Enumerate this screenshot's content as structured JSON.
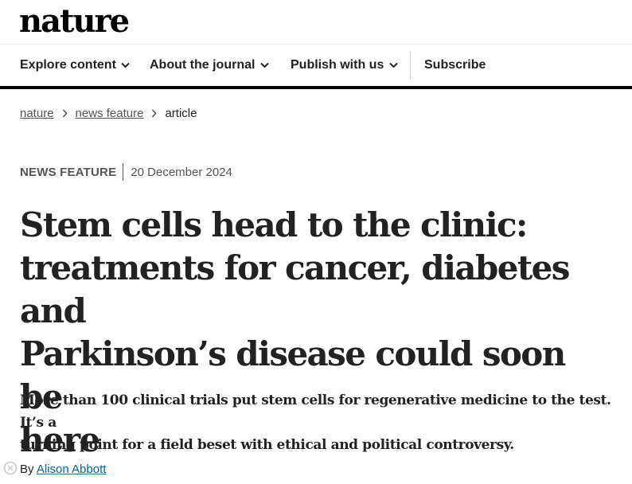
{
  "brand": {
    "logo_text": "nature"
  },
  "nav": {
    "items": [
      {
        "label": "Explore content",
        "has_dropdown": true
      },
      {
        "label": "About the journal",
        "has_dropdown": true
      },
      {
        "label": "Publish with us",
        "has_dropdown": true
      }
    ],
    "subscribe_label": "Subscribe"
  },
  "breadcrumb": {
    "items": [
      "nature",
      "news feature"
    ],
    "current": "article"
  },
  "article": {
    "type": "NEWS FEATURE",
    "date": "20 December 2024",
    "title_lines": [
      "Stem cells head to the clinic:",
      "treatments for cancer, diabetes and",
      "Parkinson’s disease could soon be",
      "here"
    ],
    "standfirst_lines": [
      "More than 100 clinical trials put stem cells for regenerative medicine to the test. It’s a",
      "turning point for a field beset with ethical and political controversy."
    ],
    "byline_prefix": "By",
    "author": "Alison Abbott"
  },
  "colors": {
    "text": "#222222",
    "muted": "#555555",
    "link": "#006699",
    "rule": "#000000"
  }
}
